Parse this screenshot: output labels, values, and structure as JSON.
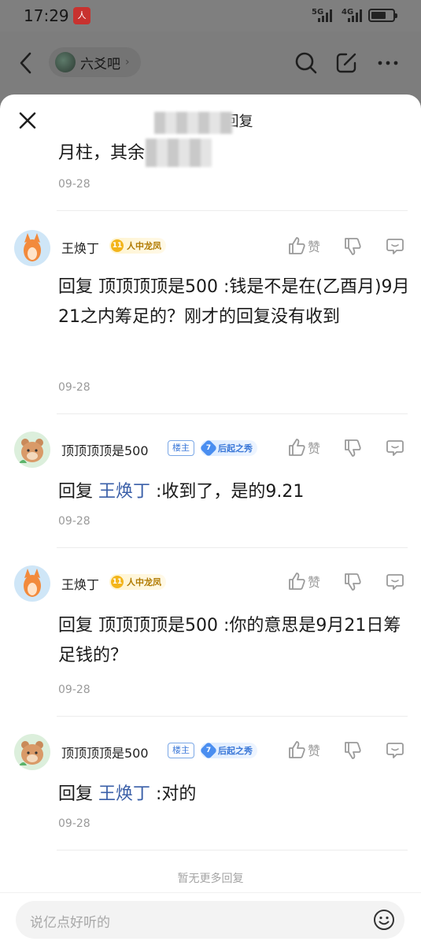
{
  "status_bar": {
    "time": "17:29",
    "app_badge": "人民日报",
    "net_left": "5G",
    "net_right": "4G",
    "battery_level": 0.7
  },
  "header": {
    "forum_name": "六爻吧",
    "chevron": "›"
  },
  "sheet": {
    "title": "回复"
  },
  "partial_post": {
    "text": "月柱，其余",
    "date": "09-28"
  },
  "comments": [
    {
      "username": "王焕丁",
      "badge": "人中龙凤",
      "badge_level": "11",
      "like_label": "赞",
      "prefix": "回复 ",
      "mention": "",
      "text": "回复 顶顶顶顶是500 :钱是不是在(乙酉月)9月21之内筹足的？刚才的回复没有收到",
      "date": "09-28"
    },
    {
      "username": "顶顶顶顶是500",
      "owner": "楼主",
      "badge": "后起之秀",
      "badge_level": "7",
      "like_label": "赞",
      "prefix": "回复 ",
      "mention": "王焕丁",
      "text": " :收到了，是的9.21",
      "date": "09-28"
    },
    {
      "username": "王焕丁",
      "badge": "人中龙凤",
      "badge_level": "11",
      "like_label": "赞",
      "prefix": "",
      "mention": "",
      "text": "回复 顶顶顶顶是500 :你的意思是9月21日筹足钱的？",
      "date": "09-28"
    },
    {
      "username": "顶顶顶顶是500",
      "owner": "楼主",
      "badge": "后起之秀",
      "badge_level": "7",
      "like_label": "赞",
      "prefix": "回复 ",
      "mention": "王焕丁",
      "text": " :对的",
      "date": "09-28"
    }
  ],
  "footer": {
    "no_more": "暂无更多回复",
    "input_placeholder": "说亿点好听的"
  }
}
